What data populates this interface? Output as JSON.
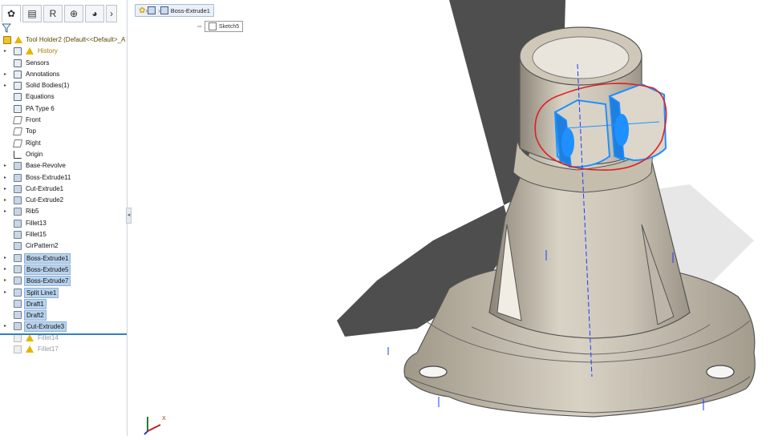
{
  "tabs": [
    {
      "name": "feature-manager",
      "glyph": "✿"
    },
    {
      "name": "property-manager",
      "glyph": "▤"
    },
    {
      "name": "configuration-manager",
      "glyph": "R"
    },
    {
      "name": "dimxpert-manager",
      "glyph": "⊕"
    },
    {
      "name": "display-manager",
      "glyph": "◕"
    },
    {
      "name": "more",
      "glyph": "›"
    }
  ],
  "tree": [
    {
      "name": "root",
      "label": "Tool Holder2  (Default<<Default>_A",
      "icon": "part",
      "warn": true,
      "expander": "",
      "highlight": false
    },
    {
      "name": "history",
      "label": "History",
      "icon": "folder",
      "warn": true,
      "expander": "▸",
      "highlight": false
    },
    {
      "name": "sensors",
      "label": "Sensors",
      "icon": "folder",
      "warn": false,
      "expander": "",
      "highlight": false
    },
    {
      "name": "annotations",
      "label": "Annotations",
      "icon": "folder",
      "warn": false,
      "expander": "▸",
      "highlight": false
    },
    {
      "name": "solid-bodies",
      "label": "Solid Bodies(1)",
      "icon": "folder",
      "warn": false,
      "expander": "▸",
      "highlight": false
    },
    {
      "name": "equations",
      "label": "Equations",
      "icon": "folder",
      "warn": false,
      "expander": "",
      "highlight": false
    },
    {
      "name": "material",
      "label": "PA Type 6",
      "icon": "material",
      "warn": false,
      "expander": "",
      "highlight": false
    },
    {
      "name": "front-plane",
      "label": "Front",
      "icon": "plane",
      "warn": false,
      "expander": "",
      "highlight": false
    },
    {
      "name": "top-plane",
      "label": "Top",
      "icon": "plane",
      "warn": false,
      "expander": "",
      "highlight": false
    },
    {
      "name": "right-plane",
      "label": "Right",
      "icon": "plane",
      "warn": false,
      "expander": "",
      "highlight": false
    },
    {
      "name": "origin",
      "label": "Origin",
      "icon": "origin",
      "warn": false,
      "expander": "",
      "highlight": false
    },
    {
      "name": "base-revolve",
      "label": "Base-Revolve",
      "icon": "feat",
      "warn": false,
      "expander": "▸",
      "highlight": false
    },
    {
      "name": "boss-extrude11",
      "label": "Boss-Extrude11",
      "icon": "feat",
      "warn": false,
      "expander": "▸",
      "highlight": false
    },
    {
      "name": "cut-extrude1",
      "label": "Cut-Extrude1",
      "icon": "feat",
      "warn": false,
      "expander": "▸",
      "highlight": false
    },
    {
      "name": "cut-extrude2",
      "label": "Cut-Extrude2",
      "icon": "feat",
      "warn": false,
      "expander": "▸",
      "highlight": false
    },
    {
      "name": "rib5",
      "label": "Rib5",
      "icon": "feat",
      "warn": false,
      "expander": "▸",
      "highlight": false
    },
    {
      "name": "fillet13",
      "label": "Fillet13",
      "icon": "feat",
      "warn": false,
      "expander": "",
      "highlight": false
    },
    {
      "name": "fillet15",
      "label": "Fillet15",
      "icon": "feat",
      "warn": false,
      "expander": "",
      "highlight": false
    },
    {
      "name": "cirpattern2",
      "label": "CirPattern2",
      "icon": "feat",
      "warn": false,
      "expander": "",
      "highlight": false
    },
    {
      "name": "boss-extrude1",
      "label": "Boss-Extrude1",
      "icon": "feat",
      "warn": false,
      "expander": "▸",
      "highlight": true
    },
    {
      "name": "boss-extrude5",
      "label": "Boss-Extrude5",
      "icon": "feat",
      "warn": false,
      "expander": "▸",
      "highlight": true
    },
    {
      "name": "boss-extrude7",
      "label": "Boss-Extrude7",
      "icon": "feat",
      "warn": false,
      "expander": "▸",
      "highlight": true
    },
    {
      "name": "split-line1",
      "label": "Split Line1",
      "icon": "feat",
      "warn": false,
      "expander": "▸",
      "highlight": true
    },
    {
      "name": "draft1",
      "label": "Draft1",
      "icon": "feat",
      "warn": false,
      "expander": "",
      "highlight": true
    },
    {
      "name": "draft2",
      "label": "Draft2",
      "icon": "feat",
      "warn": false,
      "expander": "",
      "highlight": true
    },
    {
      "name": "cut-extrude3",
      "label": "Cut-Extrude3",
      "icon": "feat",
      "warn": false,
      "expander": "▸",
      "highlight": true
    },
    {
      "name": "fillet14",
      "label": "Fillet14",
      "icon": "ghost",
      "warn": true,
      "expander": "",
      "highlight": false
    },
    {
      "name": "fillet17",
      "label": "Fillet17",
      "icon": "ghost",
      "warn": true,
      "expander": "",
      "highlight": false
    }
  ],
  "breadcrumb": {
    "feature": "Boss-Extrude1",
    "sketch": "Sketch5"
  },
  "triad": {
    "x_label": "X"
  },
  "colors": {
    "selection": "#1e90ff",
    "annotation_circle": "#e02020",
    "part_surface": "#cfc9bd",
    "axis_line": "#1a3cff"
  }
}
